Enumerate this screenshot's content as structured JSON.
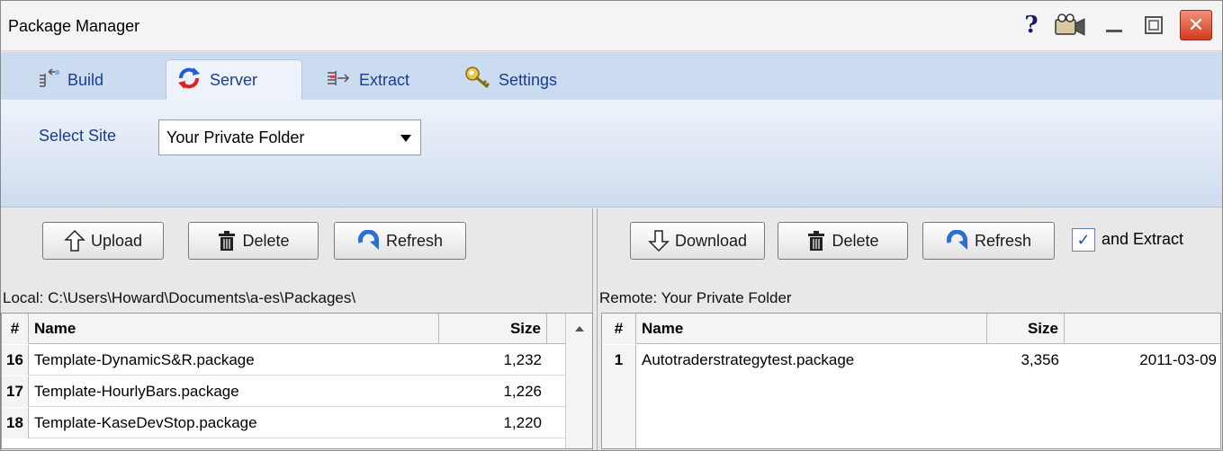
{
  "window": {
    "title": "Package Manager",
    "help_glyph": "?",
    "close_glyph": "✕"
  },
  "tabs": [
    {
      "label": "Build",
      "icon": "build-icon"
    },
    {
      "label": "Server",
      "icon": "sync-icon",
      "active": true
    },
    {
      "label": "Extract",
      "icon": "extract-icon"
    },
    {
      "label": "Settings",
      "icon": "key-icon"
    }
  ],
  "site": {
    "label": "Select Site",
    "selected": "Your Private Folder"
  },
  "local": {
    "buttons": {
      "upload": "Upload",
      "delete": "Delete",
      "refresh": "Refresh"
    },
    "path": "Local: C:\\Users\\Howard\\Documents\\a-es\\Packages\\",
    "columns": {
      "num": "#",
      "name": "Name",
      "size": "Size"
    },
    "rows": [
      {
        "num": "16",
        "name": "Template-DynamicS&R.package",
        "size": "1,232"
      },
      {
        "num": "17",
        "name": "Template-HourlyBars.package",
        "size": "1,226"
      },
      {
        "num": "18",
        "name": "Template-KaseDevStop.package",
        "size": "1,220"
      }
    ]
  },
  "remote": {
    "buttons": {
      "download": "Download",
      "delete": "Delete",
      "refresh": "Refresh"
    },
    "extract_checkbox": {
      "label": "and Extract",
      "checked": true,
      "mark": "✓"
    },
    "path": "Remote: Your Private Folder",
    "columns": {
      "num": "#",
      "name": "Name",
      "size": "Size"
    },
    "rows": [
      {
        "num": "1",
        "name": "Autotraderstrategytest.package",
        "size": "3,356",
        "date": "2011-03-09"
      }
    ]
  },
  "colors": {
    "tab_strip": "#ccdcf0",
    "tab_text": "#1a3d8f",
    "close_button": "#d23b1f",
    "refresh_icon": "#2d6fd1"
  }
}
